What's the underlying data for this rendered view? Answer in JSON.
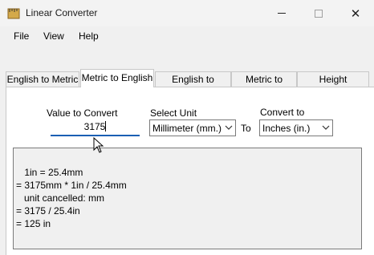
{
  "window": {
    "title": "Linear Converter",
    "close_glyph": "✕"
  },
  "menu": {
    "items": [
      "File",
      "View",
      "Help"
    ]
  },
  "tabs": [
    {
      "label": "English to Metric",
      "active": false
    },
    {
      "label": "Metric to English",
      "active": true
    },
    {
      "label": "English to English",
      "active": false
    },
    {
      "label": "Metric to Metric",
      "active": false
    },
    {
      "label": "Height Converter",
      "active": false
    }
  ],
  "form": {
    "value_label": "Value to Convert",
    "value": "3175",
    "unit_label": "Select Unit",
    "unit_selected": "Millimeter (mm.)",
    "to_label": "To",
    "convert_label": "Convert to",
    "convert_selected": "Inches (in.)"
  },
  "result": {
    "lines": [
      "    1in = 25.4mm",
      "= 3175mm * 1in / 25.4mm",
      "   unit cancelled: mm",
      "= 3175 / 25.4in",
      "= 125 in"
    ]
  },
  "icons": {
    "app": "ruler-icon",
    "cursor": "mouse-pointer-icon"
  },
  "colors": {
    "input_focus": "#1a5fb4"
  }
}
